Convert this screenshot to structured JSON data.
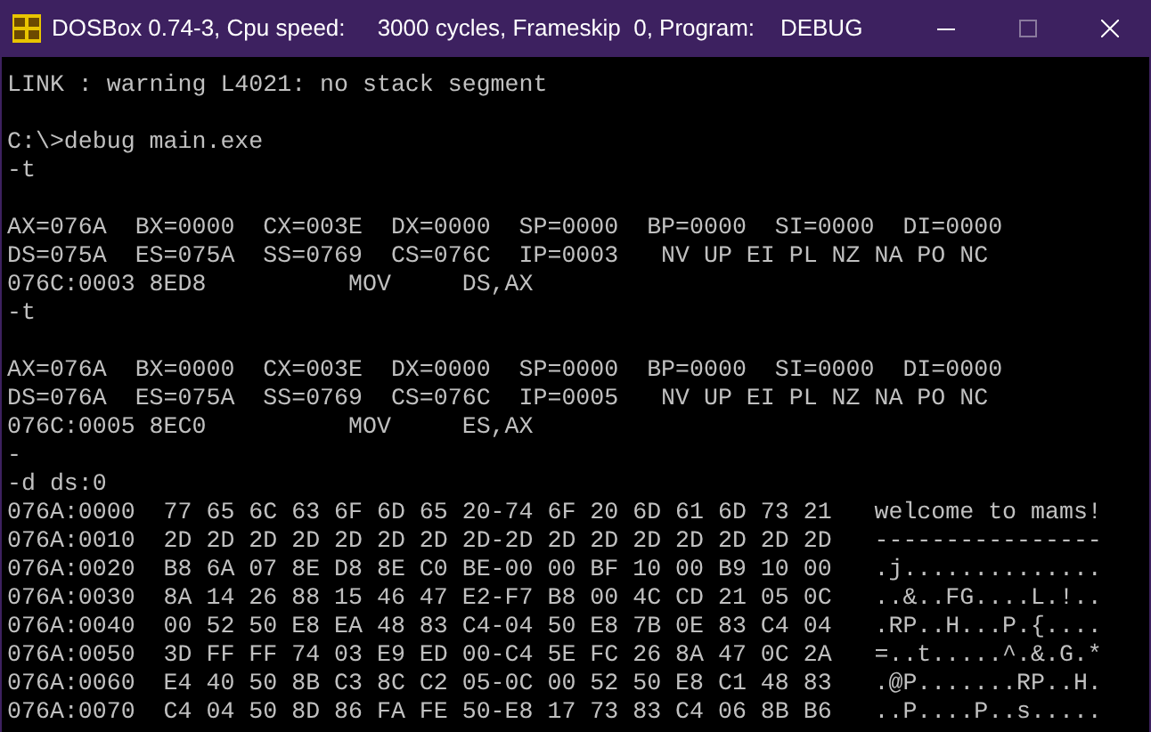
{
  "window": {
    "title": "DOSBox 0.74-3, Cpu speed:     3000 cycles, Frameskip  0, Program:    DEBUG"
  },
  "terminal": {
    "blocks": [
      [
        "LINK : warning L4021: no stack segment"
      ],
      [
        "C:\\>debug main.exe",
        "-t"
      ],
      [
        "AX=076A  BX=0000  CX=003E  DX=0000  SP=0000  BP=0000  SI=0000  DI=0000",
        "DS=075A  ES=075A  SS=0769  CS=076C  IP=0003   NV UP EI PL NZ NA PO NC",
        "076C:0003 8ED8          MOV     DS,AX",
        "-t"
      ],
      [
        "AX=076A  BX=0000  CX=003E  DX=0000  SP=0000  BP=0000  SI=0000  DI=0000",
        "DS=076A  ES=075A  SS=0769  CS=076C  IP=0005   NV UP EI PL NZ NA PO NC",
        "076C:0005 8EC0          MOV     ES,AX",
        "-",
        "-d ds:0",
        "076A:0000  77 65 6C 63 6F 6D 65 20-74 6F 20 6D 61 6D 73 21   welcome to mams!",
        "076A:0010  2D 2D 2D 2D 2D 2D 2D 2D-2D 2D 2D 2D 2D 2D 2D 2D   ----------------",
        "076A:0020  B8 6A 07 8E D8 8E C0 BE-00 00 BF 10 00 B9 10 00   .j..............",
        "076A:0030  8A 14 26 88 15 46 47 E2-F7 B8 00 4C CD 21 05 0C   ..&..FG....L.!..",
        "076A:0040  00 52 50 E8 EA 48 83 C4-04 50 E8 7B 0E 83 C4 04   .RP..H...P.{....",
        "076A:0050  3D FF FF 74 03 E9 ED 00-C4 5E FC 26 8A 47 0C 2A   =..t.....^.&.G.*",
        "076A:0060  E4 40 50 8B C3 8C C2 05-0C 00 52 50 E8 C1 48 83   .@P.......RP..H.",
        "076A:0070  C4 04 50 8D 86 FA FE 50-E8 17 73 83 C4 06 8B B6   ..P....P..s....."
      ]
    ]
  }
}
